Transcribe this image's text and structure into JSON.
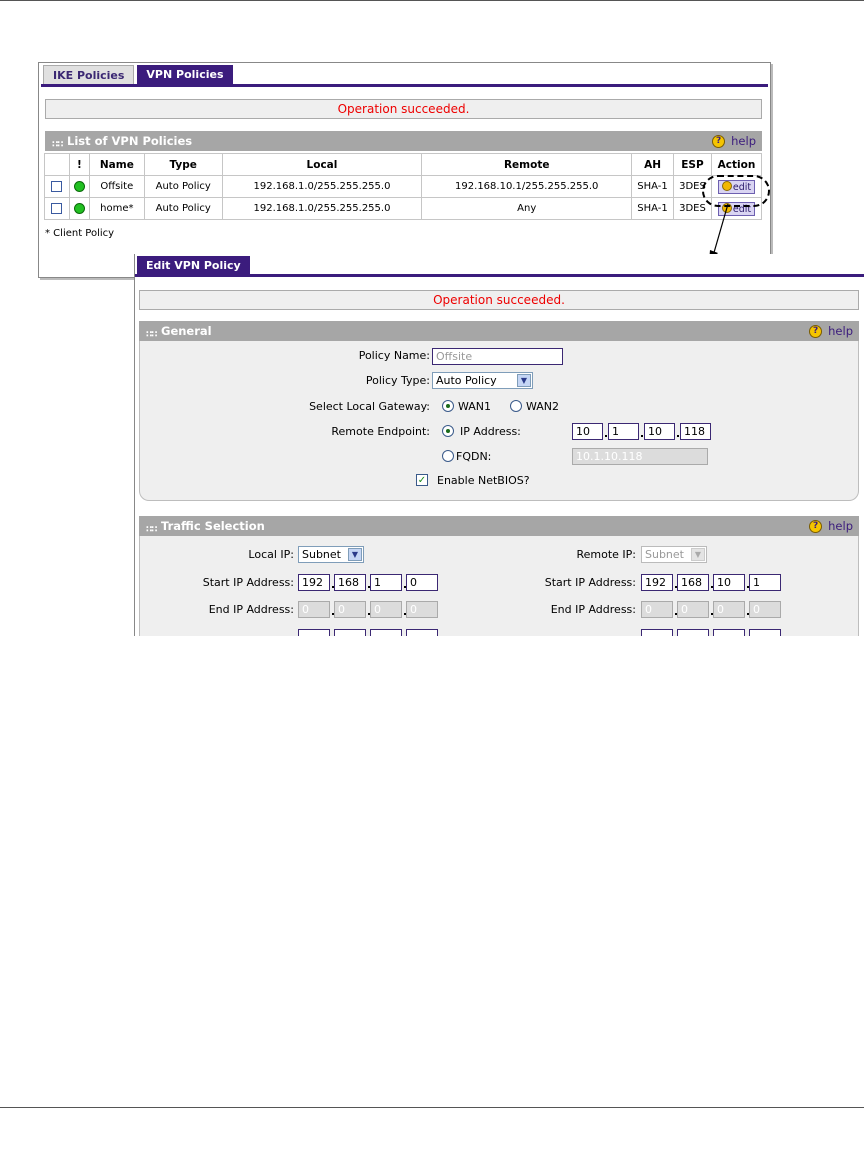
{
  "vpn_window": {
    "tabs": [
      "IKE Policies",
      "VPN Policies"
    ],
    "status": "Operation succeeded.",
    "section_title": "List of VPN Policies",
    "help_label": "help",
    "columns": [
      "!",
      "Name",
      "Type",
      "Local",
      "Remote",
      "AH",
      "ESP",
      "Action"
    ],
    "rows": [
      {
        "name": "Offsite",
        "type": "Auto Policy",
        "local": "192.168.1.0/255.255.255.0",
        "remote": "192.168.10.1/255.255.255.0",
        "ah": "SHA-1",
        "esp": "3DES",
        "action": "edit"
      },
      {
        "name": "home*",
        "type": "Auto Policy",
        "local": "192.168.1.0/255.255.255.0",
        "remote": "Any",
        "ah": "SHA-1",
        "esp": "3DES",
        "action": "edit"
      }
    ],
    "footnote": "* Client Policy"
  },
  "edit_window": {
    "tab": "Edit VPN Policy",
    "status": "Operation succeeded.",
    "help_label": "help",
    "general": {
      "title": "General",
      "policy_name_label": "Policy Name:",
      "policy_name_value": "Offsite",
      "policy_type_label": "Policy Type:",
      "policy_type_value": "Auto Policy",
      "gateway_label": "Select Local Gateway:",
      "gateway_wan1": "WAN1",
      "gateway_wan2": "WAN2",
      "remote_endpoint_label": "Remote Endpoint:",
      "ip_address_label": "IP Address:",
      "ip_octets": [
        "10",
        "1",
        "10",
        "118"
      ],
      "fqdn_label": "FQDN:",
      "fqdn_value": "10.1.10.118",
      "netbios_label": "Enable NetBIOS?"
    },
    "traffic": {
      "title": "Traffic Selection",
      "local_ip_label": "Local IP:",
      "local_ip_value": "Subnet",
      "remote_ip_label": "Remote IP:",
      "remote_ip_value": "Subnet",
      "start_ip_label": "Start IP Address:",
      "end_ip_label": "End IP Address:",
      "local_start": [
        "192",
        "168",
        "1",
        "0"
      ],
      "local_end": [
        "0",
        "0",
        "0",
        "0"
      ],
      "remote_start": [
        "192",
        "168",
        "10",
        "1"
      ],
      "remote_end": [
        "0",
        "0",
        "0",
        "0"
      ]
    }
  },
  "colors": {
    "accent": "#3b1c7d",
    "status_text": "#ee0000",
    "section_header": "#a6a6a6"
  }
}
